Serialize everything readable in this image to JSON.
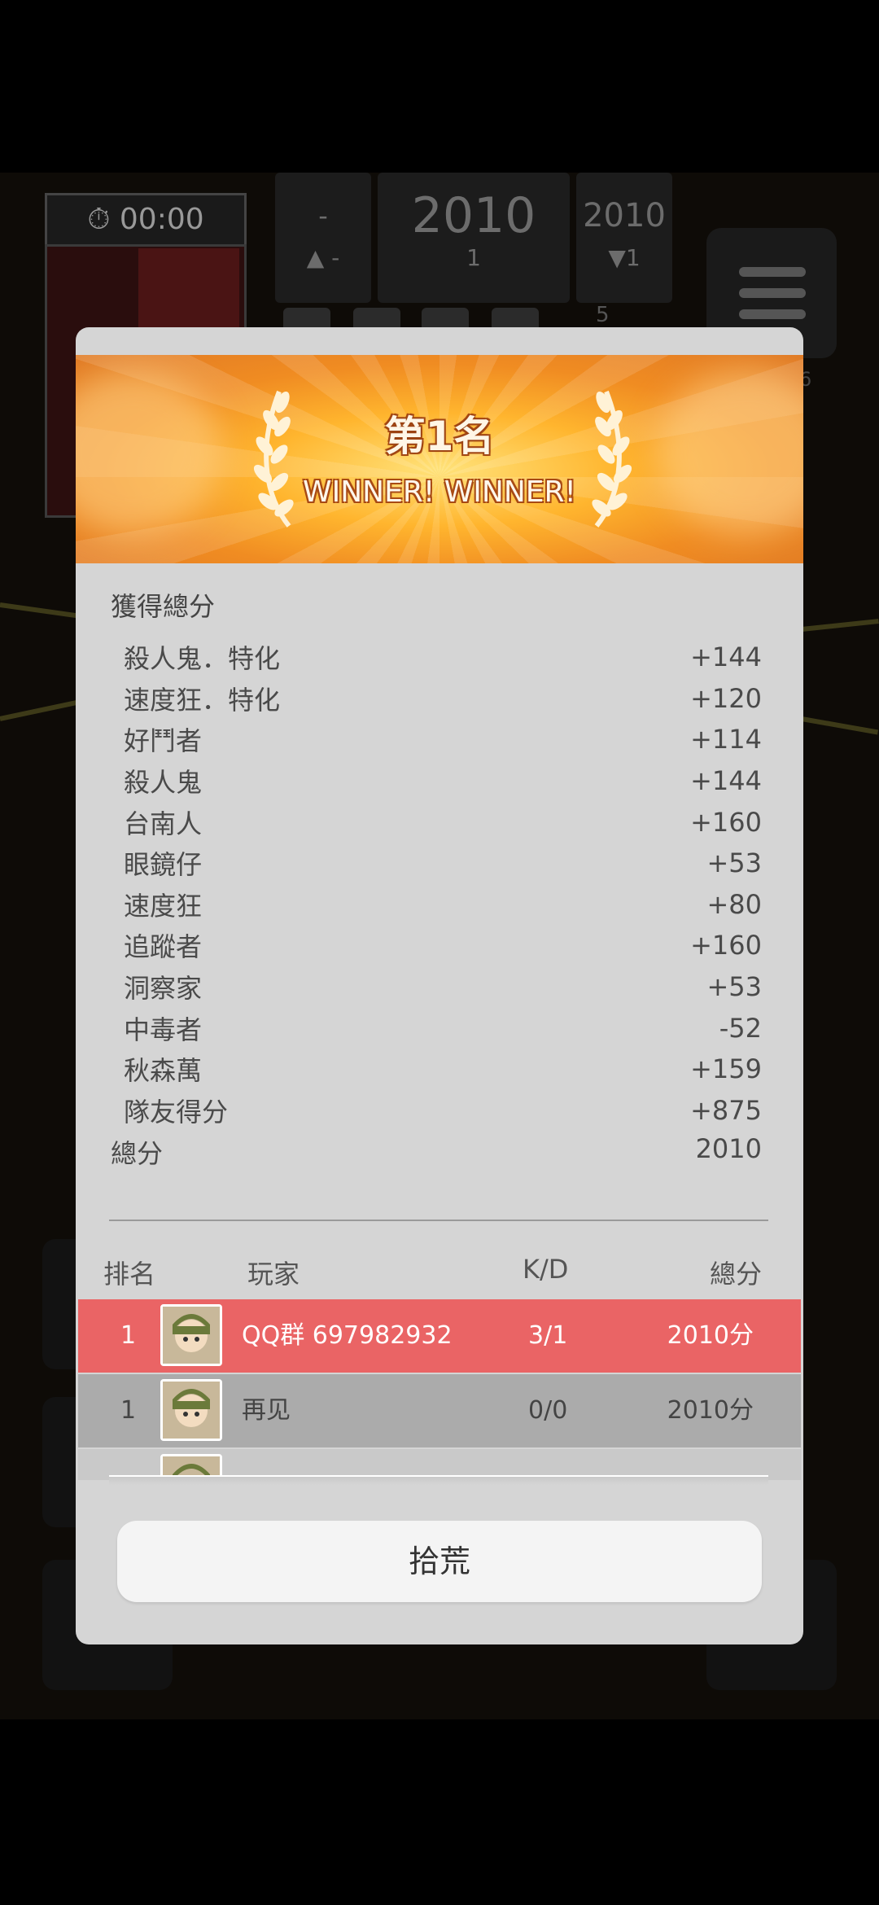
{
  "hud": {
    "timer": "00:00",
    "score_cards": [
      {
        "big": "-",
        "small": "▲ -"
      },
      {
        "big": "2010",
        "small": "1"
      },
      {
        "big": "2010",
        "small": "▼1"
      }
    ],
    "counter": "5",
    "side_count": "6"
  },
  "result": {
    "rank_title": "第1名",
    "subtitle": "WINNER! WINNER!",
    "section_title": "獲得總分",
    "score_items": [
      {
        "label": "殺人鬼．特化",
        "value": "+144"
      },
      {
        "label": "速度狂．特化",
        "value": "+120"
      },
      {
        "label": "好鬥者",
        "value": "+114"
      },
      {
        "label": "殺人鬼",
        "value": "+144"
      },
      {
        "label": "台南人",
        "value": "+160"
      },
      {
        "label": "眼鏡仔",
        "value": "+53"
      },
      {
        "label": "速度狂",
        "value": "+80"
      },
      {
        "label": "追蹤者",
        "value": "+160"
      },
      {
        "label": "洞察家",
        "value": "+53"
      },
      {
        "label": "中毒者",
        "value": "-52"
      },
      {
        "label": "秋森萬",
        "value": "+159"
      },
      {
        "label": "隊友得分",
        "value": "+875"
      }
    ],
    "total_label": "總分",
    "total_value": "2010"
  },
  "table": {
    "headers": {
      "rank": "排名",
      "player": "玩家",
      "kd": "K/D",
      "score": "總分"
    },
    "rows": [
      {
        "rank": "1",
        "player": "QQ群 697982932",
        "kd": "3/1",
        "score": "2010分"
      },
      {
        "rank": "1",
        "player": "再见",
        "kd": "0/0",
        "score": "2010分"
      }
    ]
  },
  "button_label": "拾荒",
  "colors": {
    "highlight_row": "#ea6465",
    "banner": "#f5a030",
    "dialog_bg": "#d5d5d5"
  }
}
